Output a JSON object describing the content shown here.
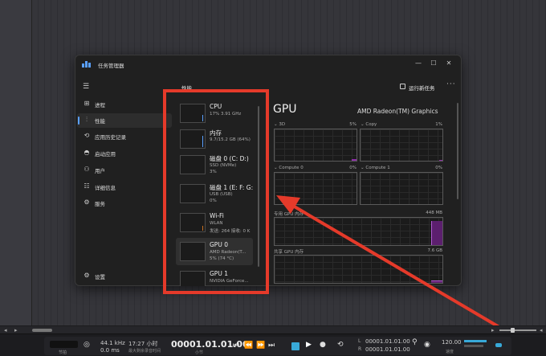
{
  "task_manager": {
    "title": "任务管理器",
    "section": "性能",
    "run_new_task": "运行新任务",
    "nav": [
      {
        "label": "进程",
        "icon": "grid-icon"
      },
      {
        "label": "性能",
        "icon": "performance-icon",
        "active": true
      },
      {
        "label": "应用历史记录",
        "icon": "history-icon"
      },
      {
        "label": "启动应用",
        "icon": "speedometer-icon"
      },
      {
        "label": "用户",
        "icon": "users-icon"
      },
      {
        "label": "详细信息",
        "icon": "list-icon"
      },
      {
        "label": "服务",
        "icon": "services-icon"
      }
    ],
    "settings": "设置",
    "devices": [
      {
        "name": "CPU",
        "sub": "17% 3.91 GHz",
        "sub2": ""
      },
      {
        "name": "内存",
        "sub": "9.7/15.2 GB (64%)",
        "sub2": ""
      },
      {
        "name": "磁盘 0 (C: D:)",
        "sub": "SSD (NVMe)",
        "sub2": "3%"
      },
      {
        "name": "磁盘 1 (E: F: G:",
        "sub": "USB (USB)",
        "sub2": "0%"
      },
      {
        "name": "Wi-Fi",
        "sub": "WLAN",
        "sub2": "发送: 264 接收: 0 K"
      },
      {
        "name": "GPU 0",
        "sub": "AMD Radeon(T...",
        "sub2": "5% (74 °C)",
        "active": true
      },
      {
        "name": "GPU 1",
        "sub": "NVIDIA GeForce...",
        "sub2": ""
      }
    ],
    "gpu": {
      "title": "GPU",
      "model": "AMD Radeon(TM) Graphics",
      "engines": [
        {
          "label": "3D",
          "pct": "5%"
        },
        {
          "label": "Copy",
          "pct": "1%"
        },
        {
          "label": "Compute 0",
          "pct": "0%"
        },
        {
          "label": "Compute 1",
          "pct": "0%"
        }
      ],
      "dedicated_label": "专用 GPU 内存",
      "dedicated_max": "448 MB",
      "shared_label": "共享 GPU 内存",
      "shared_max": "7.6 GB"
    }
  },
  "transport": {
    "track_label": "节拍",
    "sample_rate": "44.1 kHz",
    "latency": "0.0 ms",
    "time_hours": "17:27 小时",
    "time_sub": "最大剩余录音时间",
    "position": "00001.01.01.00",
    "position_unit": "小节",
    "left_locator": "00001.01.01.00",
    "right_locator": "00001.01.01.00",
    "tempo": "120.00",
    "tempo_label": "速度",
    "L": "L",
    "R": "R"
  },
  "colors": {
    "annotation": "#e53a2a",
    "accent": "#5aa0ff",
    "memory_fill": "#8e2ea8",
    "stop_button": "#38a9d8"
  }
}
